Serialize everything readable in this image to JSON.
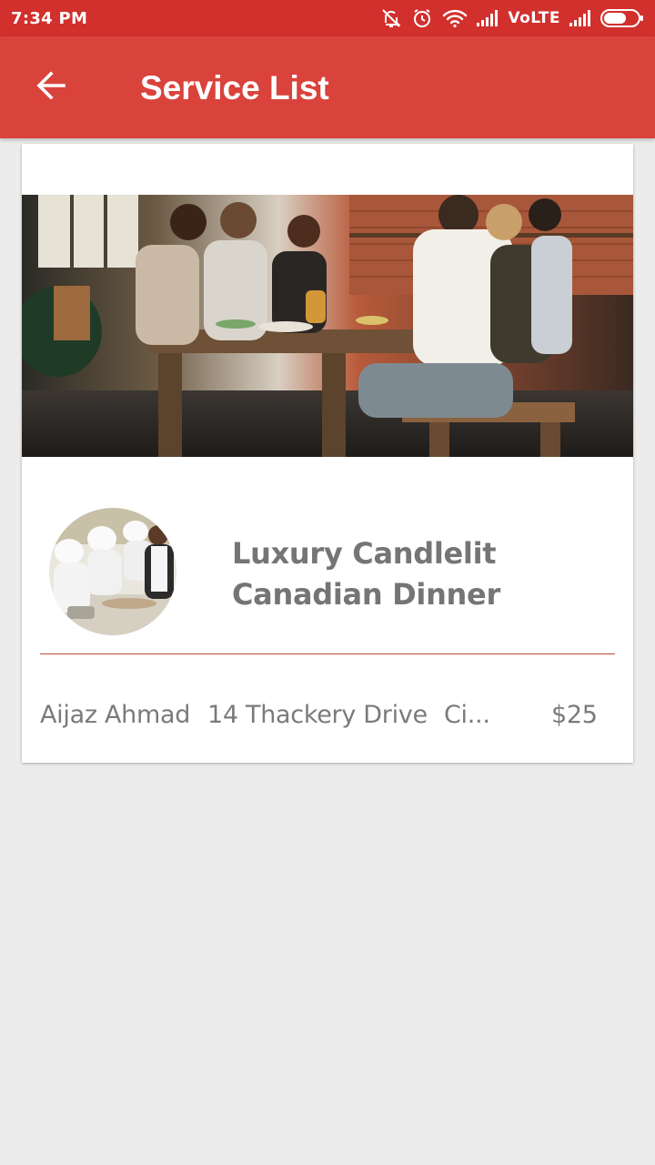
{
  "status_bar": {
    "time": "7:34 PM",
    "network": "VoLTE",
    "icons": [
      "mute-icon",
      "alarm-icon",
      "wifi-icon",
      "signal-icon",
      "signal-icon",
      "battery-icon"
    ]
  },
  "app_bar": {
    "back_icon": "arrow-left-icon",
    "title": "Service List"
  },
  "services": [
    {
      "title": "Luxury Candlelit Canadian Dinner",
      "provider": "Aijaz Ahmad",
      "address": "14 Thackery Drive",
      "city": "Ci...",
      "price": "$25",
      "hero_image": "people-dining-at-table-photo",
      "avatar_image": "chefs-cooking-photo"
    }
  ],
  "colors": {
    "status_bar": "#d1302d",
    "app_bar": "#d9433c",
    "divider": "#c0473f",
    "text_gray": "#757575",
    "background": "#ececec"
  }
}
